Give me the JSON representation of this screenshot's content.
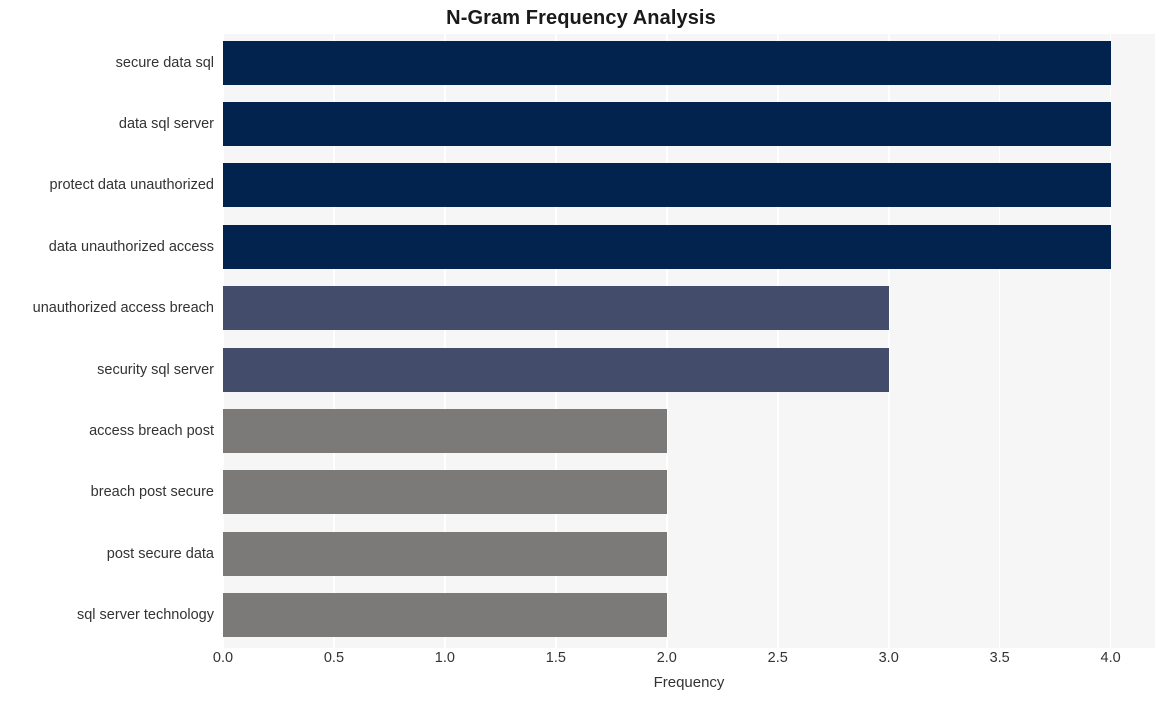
{
  "chart_data": {
    "type": "bar",
    "orientation": "horizontal",
    "title": "N-Gram Frequency Analysis",
    "xlabel": "Frequency",
    "ylabel": "",
    "xlim": [
      0,
      4.2
    ],
    "xticks": [
      "0.0",
      "0.5",
      "1.0",
      "1.5",
      "2.0",
      "2.5",
      "3.0",
      "3.5",
      "4.0"
    ],
    "xtick_values": [
      0.0,
      0.5,
      1.0,
      1.5,
      2.0,
      2.5,
      3.0,
      3.5,
      4.0
    ],
    "grid": "vertical-white-on-light-gray",
    "legend": "none",
    "categories": [
      "secure data sql",
      "data sql server",
      "protect data unauthorized",
      "data unauthorized access",
      "unauthorized access breach",
      "security sql server",
      "access breach post",
      "breach post secure",
      "post secure data",
      "sql server technology"
    ],
    "values": [
      4,
      4,
      4,
      4,
      3,
      3,
      2,
      2,
      2,
      2
    ],
    "bar_colors": [
      "#03234f",
      "#03234f",
      "#03234f",
      "#03234f",
      "#434d6b",
      "#434d6b",
      "#7b7a78",
      "#7b7a78",
      "#7b7a78",
      "#7b7a78"
    ]
  },
  "colors": {
    "plot_background": "#f6f6f6",
    "figure_background": "#ffffff",
    "gridline": "#ffffff",
    "text": "#333333",
    "title": "#1a1a1a",
    "bar_high": "#03234f",
    "bar_mid": "#434d6b",
    "bar_low": "#7b7a78"
  }
}
